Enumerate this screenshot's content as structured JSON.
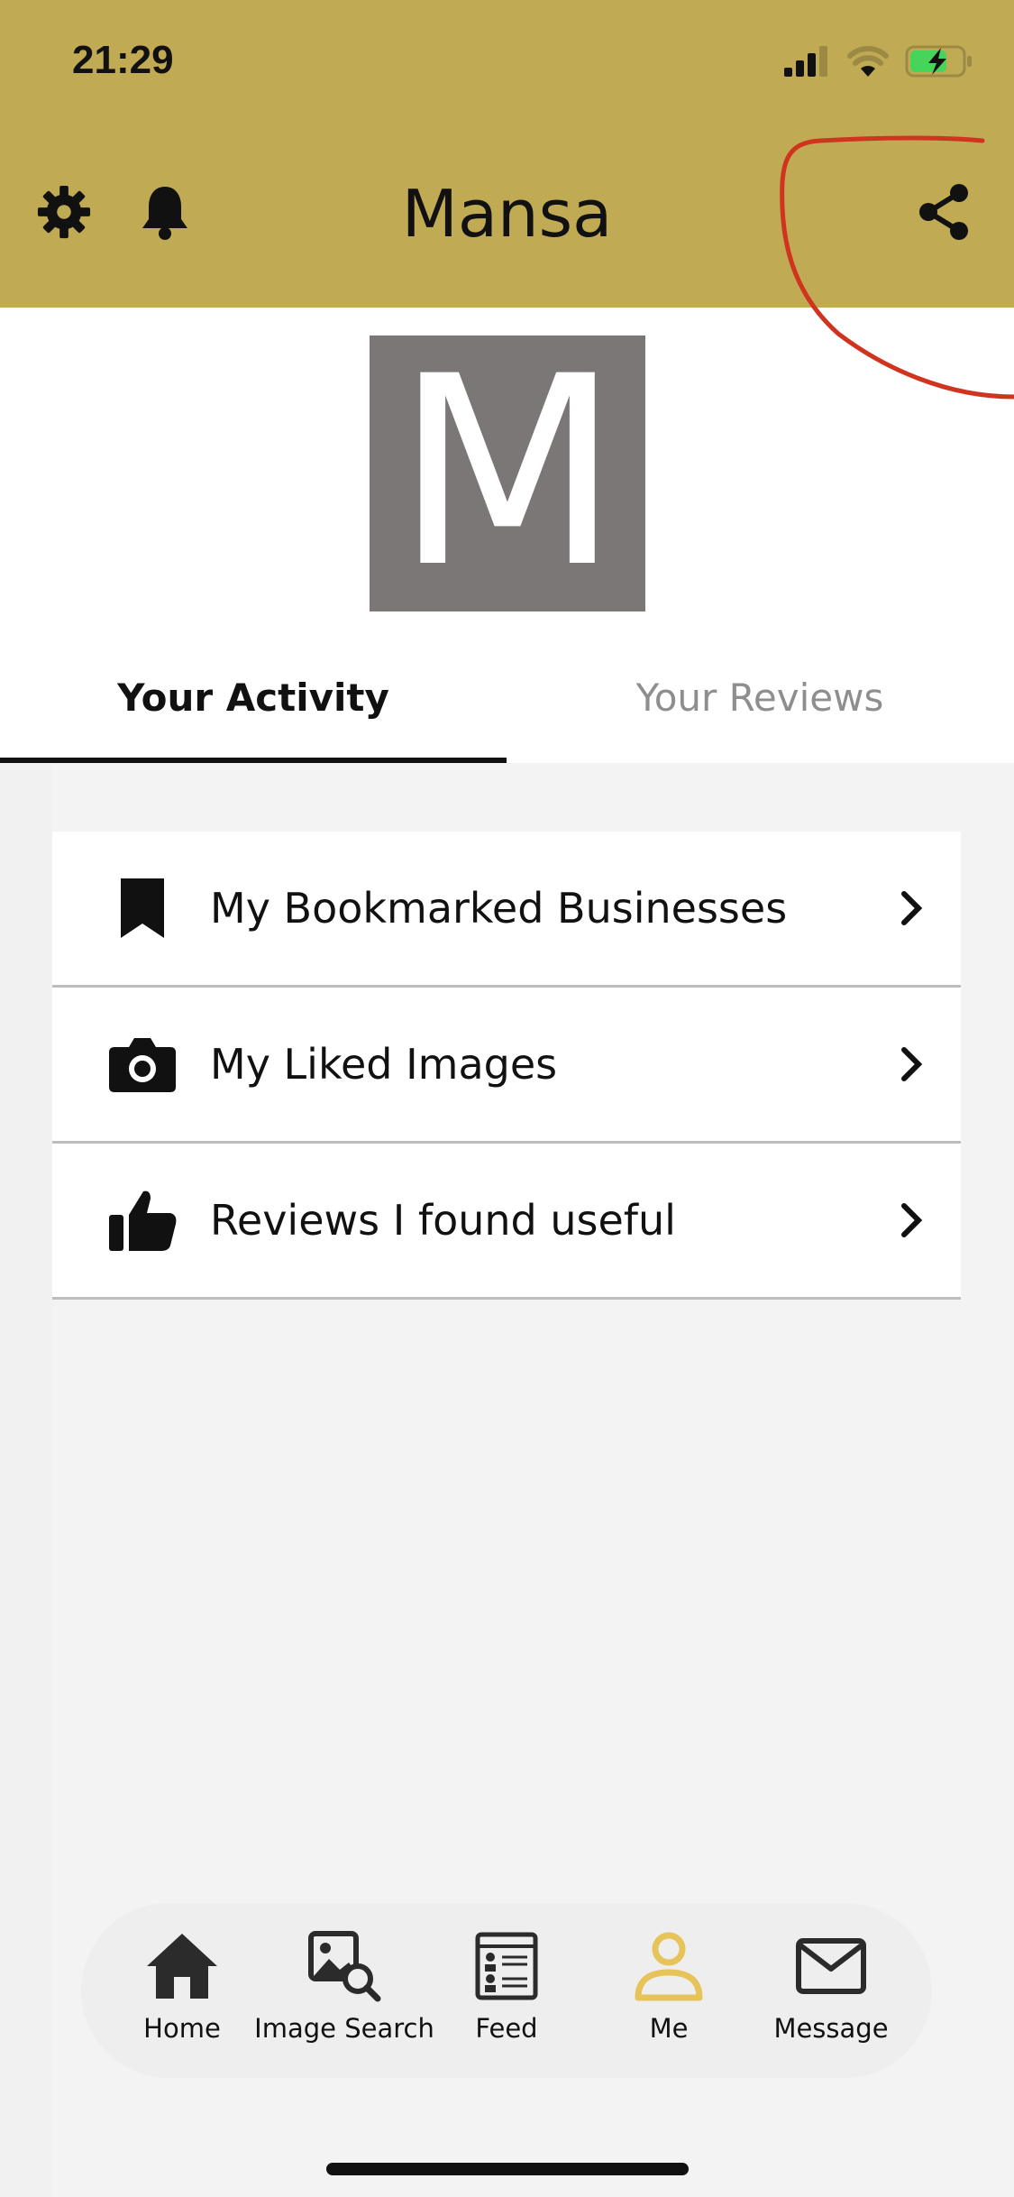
{
  "status_bar": {
    "time": "21:29"
  },
  "header": {
    "title": "Mansa",
    "background": "#c1aa54",
    "left_icons": [
      "gear-icon",
      "bell-icon"
    ],
    "right_icon": "share-icon"
  },
  "profile": {
    "avatar_letter": "M",
    "avatar_color": "#7b7777"
  },
  "tabs": [
    {
      "label": "Your Activity",
      "active": true
    },
    {
      "label": "Your Reviews",
      "active": false
    }
  ],
  "activity_items": [
    {
      "label": "My Bookmarked Businesses",
      "icon": "bookmark-icon"
    },
    {
      "label": "My Liked Images",
      "icon": "camera-icon"
    },
    {
      "label": "Reviews I found useful",
      "icon": "thumbs-up-icon"
    }
  ],
  "bottom_nav": [
    {
      "label": "Home",
      "icon": "home-icon",
      "active": false
    },
    {
      "label": "Image Search",
      "icon": "image-search-icon",
      "active": false
    },
    {
      "label": "Feed",
      "icon": "feed-icon",
      "active": false
    },
    {
      "label": "Me",
      "icon": "person-icon",
      "active": true
    },
    {
      "label": "Message",
      "icon": "envelope-icon",
      "active": false
    }
  ],
  "colors": {
    "accent": "#c1aa54",
    "active_nav": "#e6c45a",
    "annotation": "#d0341f"
  }
}
